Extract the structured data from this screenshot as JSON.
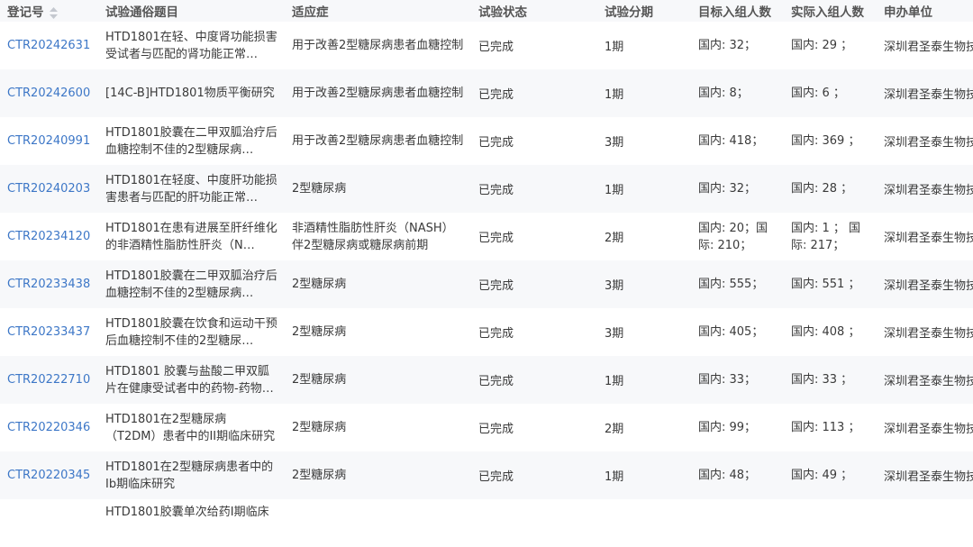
{
  "columns": [
    "登记号",
    "试验通俗题目",
    "适应症",
    "试验状态",
    "试验分期",
    "目标入组人数",
    "实际入组人数",
    "申办单位"
  ],
  "rows": [
    {
      "reg": "CTR20242631",
      "title": "HTD1801在轻、中度肾功能损害受试者与匹配的肾功能正常…",
      "indication": "用于改善2型糖尿病患者血糖控制",
      "status": "已完成",
      "phase": "1期",
      "target": "国内: 32；",
      "actual": "国内: 29 ；",
      "sponsor": "深圳君圣泰生物技"
    },
    {
      "reg": "CTR20242600",
      "title": "[14C-B]HTD1801物质平衡研究",
      "indication": "用于改善2型糖尿病患者血糖控制",
      "status": "已完成",
      "phase": "1期",
      "target": "国内: 8；",
      "actual": "国内: 6 ；",
      "sponsor": "深圳君圣泰生物技"
    },
    {
      "reg": "CTR20240991",
      "title": "HTD1801胶囊在二甲双胍治疗后血糖控制不佳的2型糖尿病…",
      "indication": "用于改善2型糖尿病患者血糖控制",
      "status": "已完成",
      "phase": "3期",
      "target": "国内: 418；",
      "actual": "国内: 369 ；",
      "sponsor": "深圳君圣泰生物技"
    },
    {
      "reg": "CTR20240203",
      "title": "HTD1801在轻度、中度肝功能损害患者与匹配的肝功能正常…",
      "indication": "2型糖尿病",
      "status": "已完成",
      "phase": "1期",
      "target": "国内: 32；",
      "actual": "国内: 28 ；",
      "sponsor": "深圳君圣泰生物技"
    },
    {
      "reg": "CTR20234120",
      "title": "HTD1801在患有进展至肝纤维化的非酒精性脂肪性肝炎（N…",
      "indication": "非酒精性脂肪性肝炎（NASH）伴2型糖尿病或糖尿病前期",
      "status": "已完成",
      "phase": "2期",
      "target": "国内: 20；国际: 210；",
      "actual": "国内: 1 ；  国际: 217；",
      "sponsor": "深圳君圣泰生物技"
    },
    {
      "reg": "CTR20233438",
      "title": "HTD1801胶囊在二甲双胍治疗后血糖控制不佳的2型糖尿病…",
      "indication": "2型糖尿病",
      "status": "已完成",
      "phase": "3期",
      "target": "国内: 555；",
      "actual": "国内: 551 ；",
      "sponsor": "深圳君圣泰生物技"
    },
    {
      "reg": "CTR20233437",
      "title": "HTD1801胶囊在饮食和运动干预后血糖控制不佳的2型糖尿…",
      "indication": "2型糖尿病",
      "status": "已完成",
      "phase": "3期",
      "target": "国内: 405；",
      "actual": "国内: 408 ；",
      "sponsor": "深圳君圣泰生物技"
    },
    {
      "reg": "CTR20222710",
      "title": "HTD1801 胶囊与盐酸二甲双胍片在健康受试者中的药物-药物…",
      "indication": "2型糖尿病",
      "status": "已完成",
      "phase": "1期",
      "target": "国内: 33；",
      "actual": "国内: 33 ；",
      "sponsor": "深圳君圣泰生物技"
    },
    {
      "reg": "CTR20220346",
      "title": "HTD1801在2型糖尿病（T2DM）患者中的II期临床研究",
      "indication": "2型糖尿病",
      "status": "已完成",
      "phase": "2期",
      "target": "国内: 99；",
      "actual": "国内: 113 ；",
      "sponsor": "深圳君圣泰生物技"
    },
    {
      "reg": "CTR20220345",
      "title": "HTD1801在2型糖尿病患者中的Ib期临床研究",
      "indication": "2型糖尿病",
      "status": "已完成",
      "phase": "1期",
      "target": "国内: 48；",
      "actual": "国内: 49 ；",
      "sponsor": "深圳君圣泰生物技"
    },
    {
      "reg": "",
      "title": "HTD1801胶囊单次给药I期临床",
      "indication": "",
      "status": "",
      "phase": "",
      "target": "",
      "actual": "",
      "sponsor": ""
    }
  ],
  "icons": {
    "sort": "sort-icon"
  },
  "colors": {
    "link": "#3d77c7",
    "header_bg": "#f7f8fa",
    "stripe_bg": "#f7f8fa",
    "text": "#3a3a3a"
  }
}
